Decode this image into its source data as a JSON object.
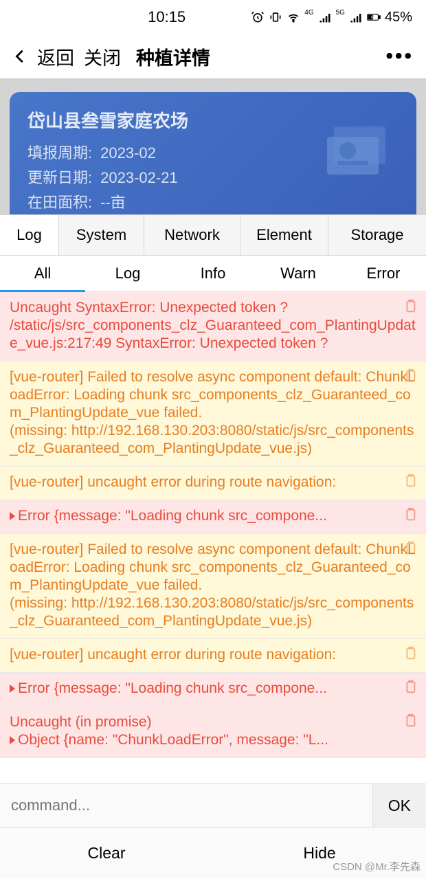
{
  "status": {
    "time": "10:15",
    "battery": "45%"
  },
  "nav": {
    "back": "返回",
    "close": "关闭",
    "title": "种植详情"
  },
  "card": {
    "title": "岱山县叁雪家庭农场",
    "rows": [
      {
        "label": "填报周期:",
        "value": "2023-02"
      },
      {
        "label": "更新日期:",
        "value": "2023-02-21"
      },
      {
        "label": "在田面积:",
        "value": "--亩"
      }
    ]
  },
  "devtools": {
    "main_tabs": [
      "Log",
      "System",
      "Network",
      "Element",
      "Storage"
    ],
    "sub_tabs": [
      "All",
      "Log",
      "Info",
      "Warn",
      "Error"
    ],
    "logs": [
      {
        "type": "error",
        "text": "Uncaught SyntaxError: Unexpected token ?\n/static/js/src_components_clz_Guaranteed_com_PlantingUpdate_vue.js:217:49 SyntaxError: Unexpected token ?"
      },
      {
        "type": "warn",
        "text": "[vue-router] Failed to resolve async component default: ChunkLoadError: Loading chunk src_components_clz_Guaranteed_com_PlantingUpdate_vue failed.\n(missing: http://192.168.130.203:8080/static/js/src_components_clz_Guaranteed_com_PlantingUpdate_vue.js)"
      },
      {
        "type": "warn",
        "text": "[vue-router] uncaught error during route navigation:"
      },
      {
        "type": "error",
        "expand": true,
        "text": "Error {message: \"Loading chunk src_compone..."
      },
      {
        "type": "warn",
        "text": "[vue-router] Failed to resolve async component default: ChunkLoadError: Loading chunk src_components_clz_Guaranteed_com_PlantingUpdate_vue failed.\n(missing: http://192.168.130.203:8080/static/js/src_components_clz_Guaranteed_com_PlantingUpdate_vue.js)"
      },
      {
        "type": "warn",
        "text": "[vue-router] uncaught error during route navigation:"
      },
      {
        "type": "error",
        "expand": true,
        "text": "Error {message: \"Loading chunk src_compone..."
      },
      {
        "type": "error",
        "text": "Uncaught (in promise)",
        "extra": "Object {name: \"ChunkLoadError\", message: \"L...",
        "extra_expand": true
      }
    ],
    "cmd_placeholder": "command...",
    "ok": "OK",
    "clear": "Clear",
    "hide": "Hide"
  },
  "watermark": "CSDN @Mr.李先森"
}
